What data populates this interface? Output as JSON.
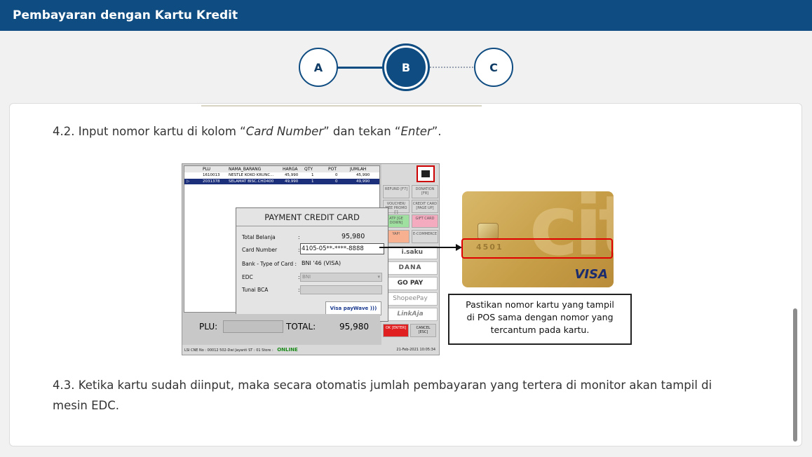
{
  "header": {
    "title": "Pembayaran dengan Kartu Kredit"
  },
  "stepper": {
    "steps": [
      "A",
      "B",
      "C"
    ],
    "active": "B"
  },
  "content": {
    "step_42": {
      "prefix": "4.2.  Input nomor kartu di kolom “",
      "em1": "Card Number",
      "mid": "” dan tekan “",
      "em2": "Enter",
      "suffix": "”."
    },
    "step_43": {
      "line1": "4.3.  Ketika kartu sudah diinput, maka secara otomatis jumlah pembayaran yang tertera di monitor akan tampil di",
      "line2": "mesin EDC."
    },
    "callout": {
      "line1": "Pastikan nomor kartu yang tampil",
      "line2": "di POS sama dengan nomor yang",
      "line3": "tercantum pada kartu."
    }
  },
  "pos": {
    "columns": [
      "PLU",
      "NAMA_BARANG",
      "HARGA",
      "QTY",
      "POT",
      "JUMLAH"
    ],
    "rows": [
      [
        "1610013",
        "NESTLE KOKO KRUNC...",
        "45,990",
        "1",
        "0",
        "45,990"
      ],
      [
        "2031378",
        "SELAMAT BISC.CHD400",
        "49,990",
        "1",
        "0",
        "49,990"
      ]
    ],
    "dialog": {
      "title": "PAYMENT CREDIT CARD",
      "total_label": "Total Belanja",
      "total_value": "95,980",
      "card_label": "Card Number",
      "card_value": "4105-05**-****-8888",
      "bank_label": "Bank - Type of Card :",
      "bank_value": "BNI '46 (VISA)",
      "edc_label": "EDC",
      "edc_value": "BNI",
      "tunai_label": "Tunai BCA",
      "paywave": "Visa payWave"
    },
    "side_buttons": [
      {
        "label": "REFUND [F7]",
        "color": "#c9d3dd"
      },
      {
        "label": "DONATION [F8]",
        "color": "#c9d3dd"
      },
      {
        "label": "VOUCHER/ MEE PROMO [']",
        "color": "#c9d3dd"
      },
      {
        "label": "CREDIT CARD [PAGE UP]",
        "color": "#c9d3dd"
      },
      {
        "label": "ATP [GE DOWN]",
        "color": "#9fe0a0"
      },
      {
        "label": "GIFT CARD",
        "color": "#f4aabf"
      },
      {
        "label": "YAP!",
        "color": "#f7b190"
      },
      {
        "label": "E-COMMERCE",
        "color": "#c9d3dd"
      }
    ],
    "wallets": [
      "i.saku",
      "DANA",
      "GO PAY",
      "ShopeePay",
      "LinkAja"
    ],
    "ok_label": "OK [ENTER]",
    "cancel_label": "CANCEL [ESC]",
    "plu_label": "PLU:",
    "total_label": "TOTAL:",
    "total_value": "95,980",
    "status_left": "LSI CNE  No : 00012  502-Dwi Jayanti  ST : 01  Store :",
    "status_online": "ONLINE",
    "status_date": "21-Feb-2021 10:05:34"
  },
  "card": {
    "brand": "VISA",
    "logo_text": "citi",
    "number_fragment": "4501"
  },
  "colors": {
    "header_bg": "#0f4c81",
    "accent": "#0f4c81",
    "highlight": "#e00000"
  }
}
